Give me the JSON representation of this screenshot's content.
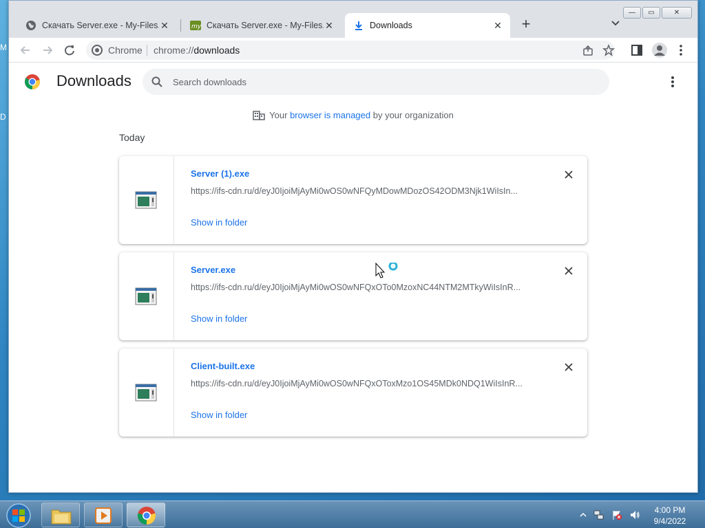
{
  "desktop": {
    "left_letters": [
      "M",
      "D"
    ]
  },
  "window": {
    "controls": {
      "minimize": "—",
      "maximize": "▭",
      "close": "✕"
    }
  },
  "tabs": [
    {
      "title": "Скачать Server.exe - My-Files.SU",
      "favicon": "globe-icon",
      "active": false
    },
    {
      "title": "Скачать Server.exe - My-Files.SU",
      "favicon": "myfiles-icon",
      "active": false
    },
    {
      "title": "Downloads",
      "favicon": "download-icon",
      "active": true
    }
  ],
  "omnibox": {
    "site_label": "Chrome",
    "url_scheme": "chrome://",
    "url_host": "downloads"
  },
  "page": {
    "title": "Downloads",
    "search_placeholder": "Search downloads",
    "managed": {
      "prefix": "Your ",
      "link": "browser is managed",
      "suffix": " by your organization"
    },
    "section_label": "Today",
    "downloads": [
      {
        "filename": "Server (1).exe",
        "url": "https://ifs-cdn.ru/d/eyJ0IjoiMjAyMi0wOS0wNFQyMDowMDozOS42ODM3Njk1WiIsIn...",
        "action": "Show in folder"
      },
      {
        "filename": "Server.exe",
        "url": "https://ifs-cdn.ru/d/eyJ0IjoiMjAyMi0wOS0wNFQxOTo0MzoxNC44NTM2MTkyWiIsInR...",
        "action": "Show in folder"
      },
      {
        "filename": "Client-built.exe",
        "url": "https://ifs-cdn.ru/d/eyJ0IjoiMjAyMi0wOS0wNFQxOToxMzo1OS45MDk0NDQ1WiIsInR...",
        "action": "Show in folder"
      }
    ]
  },
  "taskbar": {
    "time": "4:00 PM",
    "date": "9/4/2022"
  },
  "colors": {
    "link": "#1a73e8",
    "tabstrip": "#dee1e6",
    "taskbar": "#3d6e98"
  }
}
